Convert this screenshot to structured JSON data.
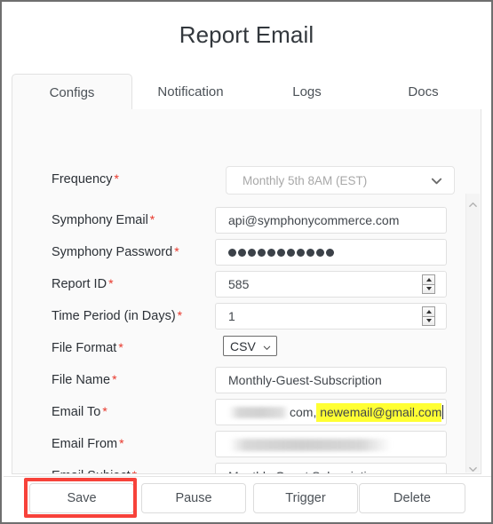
{
  "page_title": "Report Email",
  "tabs": [
    {
      "label": "Configs",
      "active": true
    },
    {
      "label": "Notification",
      "active": false
    },
    {
      "label": "Logs",
      "active": false
    },
    {
      "label": "Docs",
      "active": false
    }
  ],
  "form": {
    "required_marker": "*",
    "fields": [
      {
        "label": "Frequency",
        "type": "dropdown",
        "value": "Monthly 5th 8AM (EST)",
        "disabled": true
      },
      {
        "label": "Symphony Email",
        "type": "text",
        "value": "api@symphonycommerce.com"
      },
      {
        "label": "Symphony Password",
        "type": "password",
        "value": "●●●●●●●●●●●",
        "dots": 11
      },
      {
        "label": "Report ID",
        "type": "number",
        "value": "585"
      },
      {
        "label": "Time Period (in Days)",
        "type": "number",
        "value": "1"
      },
      {
        "label": "File Format",
        "type": "select",
        "value": "CSV",
        "options": [
          "CSV"
        ]
      },
      {
        "label": "File Name",
        "type": "text",
        "value": "Monthly-Guest-Subscription"
      },
      {
        "label": "Email To",
        "type": "email-composite",
        "redacted": true,
        "value_visible": "com,",
        "value_highlighted": "newemail@gmail.com"
      },
      {
        "label": "Email From",
        "type": "text",
        "value": "",
        "redacted": true
      },
      {
        "label": "Email Subject",
        "type": "text",
        "value": "Monthly Guest Subscription"
      }
    ]
  },
  "buttons": [
    {
      "label": "Save",
      "annotated": true
    },
    {
      "label": "Pause",
      "annotated": false
    },
    {
      "label": "Trigger",
      "annotated": false
    },
    {
      "label": "Delete",
      "annotated": false
    }
  ],
  "colors": {
    "required_asterisk": "#e8362a",
    "annotation_box": "#f7423a",
    "highlight": "#ffff33",
    "text": "#2c3137",
    "panel_bg": "#fafafa"
  },
  "scrollbar": {
    "up_icon": "chevron-up-icon",
    "down_icon": "chevron-down-icon"
  }
}
